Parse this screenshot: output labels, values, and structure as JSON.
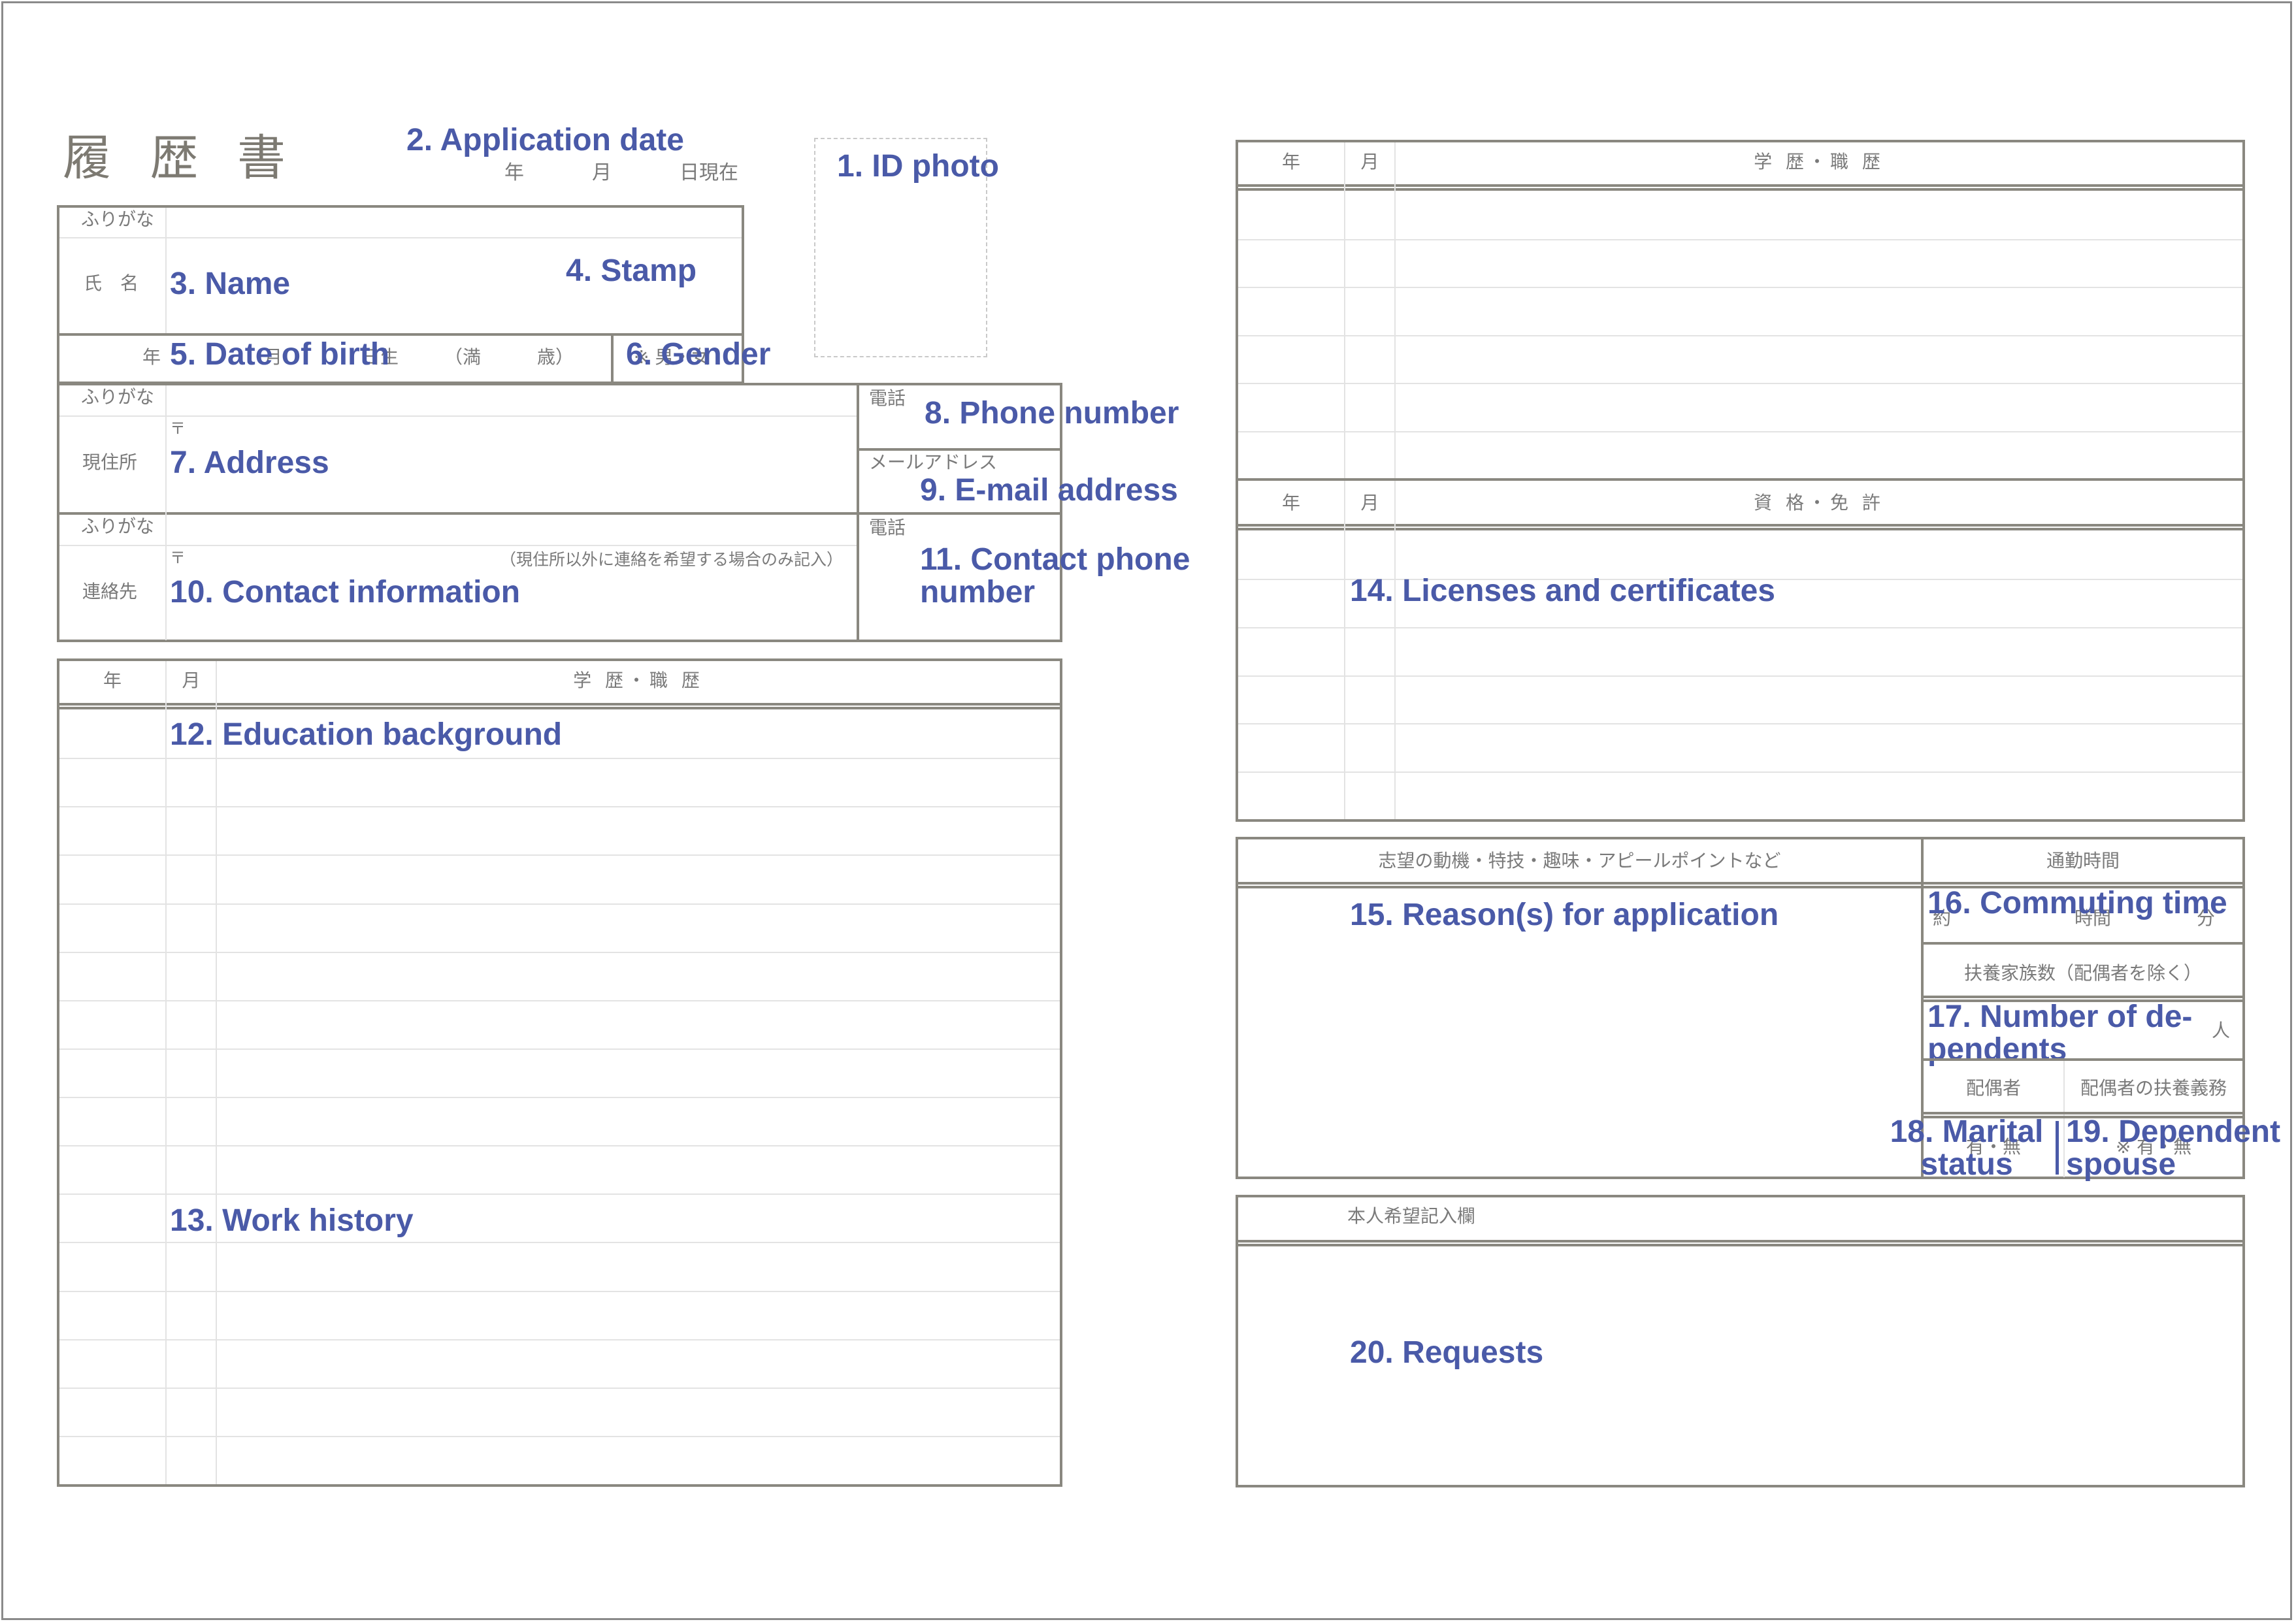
{
  "document": {
    "title": "履 歴 書",
    "date_line": {
      "year": "年",
      "month": "月",
      "day_suffix": "日現在"
    }
  },
  "annotations": {
    "id_photo": "1. ID photo",
    "application_date": "2. Application date",
    "name": "3. Name",
    "stamp": "4. Stamp",
    "date_of_birth": "5. Date of birth",
    "gender": "6. Gender",
    "address": "7. Address",
    "phone_number": "8. Phone number",
    "email_address": "9. E-mail address",
    "contact_information": "10. Contact information",
    "contact_phone_number": "11. Contact phone number",
    "education_background": "12. Education background",
    "work_history": "13. Work history",
    "licenses_certificates": "14. Licenses and certificates",
    "reasons_for_application": "15. Reason(s) for application",
    "commuting_time": "16. Commuting time",
    "number_of_dependents": "17. Number of de- pendents",
    "marital_status": "18. Marital status",
    "dependent_spouse": "19. Dependent spouse",
    "requests": "20. Requests"
  },
  "name_block": {
    "furigana_label": "ふりがな",
    "name_label": "氏　名"
  },
  "birth_row": {
    "year": "年",
    "month": "月",
    "day_born": "日生",
    "age_open": "（満",
    "age_close": "歳）",
    "gender_options": "※ 男・女"
  },
  "address_block": {
    "furigana_label": "ふりがな",
    "postal_mark": "〒",
    "address_label": "現住所",
    "phone_label": "電話",
    "email_label": "メールアドレス"
  },
  "contact_block": {
    "furigana_label": "ふりがな",
    "postal_mark": "〒",
    "contact_label": "連絡先",
    "note": "（現住所以外に連絡を希望する場合のみ記入）",
    "phone_label": "電話"
  },
  "history_left": {
    "columns": [
      "年",
      "月",
      "学 歴・職 歴"
    ],
    "row_count": 16
  },
  "history_right": {
    "columns": [
      "年",
      "月",
      "学 歴・職 歴"
    ],
    "row_count": 6
  },
  "licenses": {
    "columns": [
      "年",
      "月",
      "資 格・免 許"
    ],
    "row_count": 6
  },
  "motivation": {
    "header": "志望の動機・特技・趣味・アピールポイントなど",
    "commute_header": "通勤時間",
    "commute_prefix": "約",
    "commute_hours": "時間",
    "commute_minutes": "分",
    "dependents_header": "扶養家族数（配偶者を除く）",
    "dependents_unit": "人",
    "spouse_header": "配偶者",
    "spouse_support_header": "配偶者の扶養義務",
    "spouse_options": "有・無",
    "spouse_support_options": "※ 有・無"
  },
  "requests": {
    "header": "本人希望記入欄"
  }
}
